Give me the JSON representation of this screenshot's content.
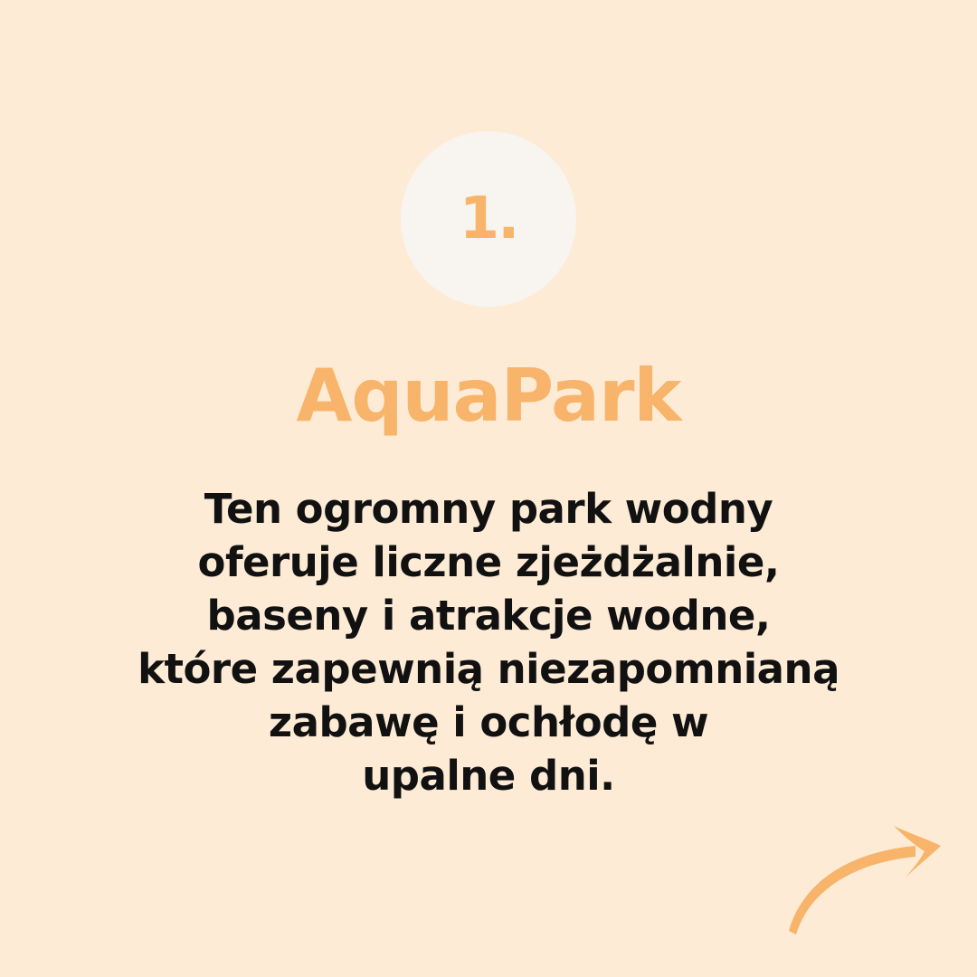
{
  "badge": {
    "number": "1."
  },
  "title": "AquaPark",
  "description": {
    "lines": [
      "Ten ogromny park wodny",
      "oferuje liczne zjeżdżalnie,",
      "baseny i atrakcje wodne,",
      "które zapewnią niezapomnianą",
      "zabawę i ochłodę w",
      "upalne dni."
    ]
  },
  "next_arrow": {
    "icon": "curved-arrow-right-icon"
  },
  "colors": {
    "background": "#FDEBD6",
    "accent": "#F7B46A",
    "badge_circle": "#F8F4EF",
    "text": "#111111"
  }
}
